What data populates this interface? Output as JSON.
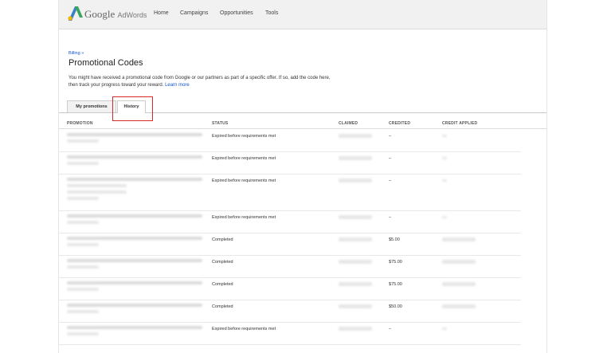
{
  "header": {
    "brand": "Google",
    "product": "AdWords",
    "nav": [
      "Home",
      "Campaigns",
      "Opportunities",
      "Tools"
    ]
  },
  "breadcrumb": "Billing »",
  "page_title": "Promotional Codes",
  "description": {
    "line1": "You might have received a promotional code from Google or our partners as part of a specific offer. If so, add the code here,",
    "line2": "then track your progress toward your reward.",
    "link": "Learn more"
  },
  "tabs": [
    "My promotions",
    "History"
  ],
  "active_tab": "History",
  "columns": [
    "PROMOTION",
    "STATUS",
    "CLAIMED",
    "CREDITED",
    "CREDIT APPLIED"
  ],
  "rows": [
    {
      "status": "Expired before requirements met",
      "credited": "–"
    },
    {
      "status": "Expired before requirements met",
      "credited": "–"
    },
    {
      "status": "Expired before requirements met",
      "credited": "–"
    },
    {
      "status": "Expired before requirements met",
      "credited": "–"
    },
    {
      "status": "Completed",
      "credited": "$5.00"
    },
    {
      "status": "Completed",
      "credited": "$75.00"
    },
    {
      "status": "Completed",
      "credited": "$75.00"
    },
    {
      "status": "Completed",
      "credited": "$50.00"
    },
    {
      "status": "Expired before requirements met",
      "credited": "–"
    }
  ],
  "colors": {
    "link": "#1155cc",
    "highlight": "#d42a2a",
    "logo_blue": "#3b82c4",
    "logo_green": "#3ba55c",
    "logo_yellow": "#f4b400"
  }
}
